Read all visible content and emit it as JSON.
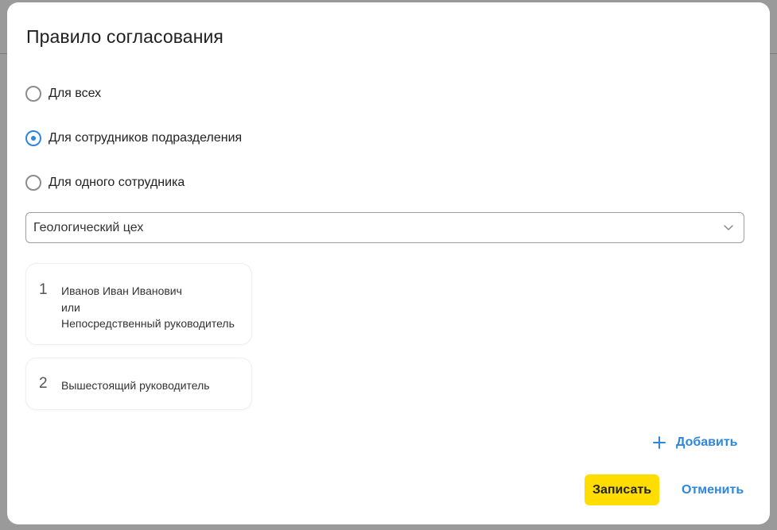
{
  "dialog": {
    "title": "Правило согласования"
  },
  "rule_options": [
    {
      "label": "Для всех",
      "checked": false
    },
    {
      "label": "Для сотрудников подразделения",
      "checked": true
    },
    {
      "label": "Для одного сотрудника",
      "checked": false
    }
  ],
  "department_select": {
    "value": "Геологический цех",
    "icon": "chevron-down-icon"
  },
  "approval_steps": [
    {
      "number": "1",
      "lines": [
        "Иванов Иван Иванович",
        "или",
        "Непосредственный руководитель"
      ]
    },
    {
      "number": "2",
      "lines": [
        "Вышестоящий руководитель"
      ]
    }
  ],
  "actions": {
    "add_label": "Добавить",
    "add_icon": "plus-icon",
    "save_label": "Записать",
    "cancel_label": "Отменить"
  },
  "colors": {
    "accent": "#2e86de",
    "primary_button": "#ffdd00",
    "overlay": "#9a9a9a"
  }
}
